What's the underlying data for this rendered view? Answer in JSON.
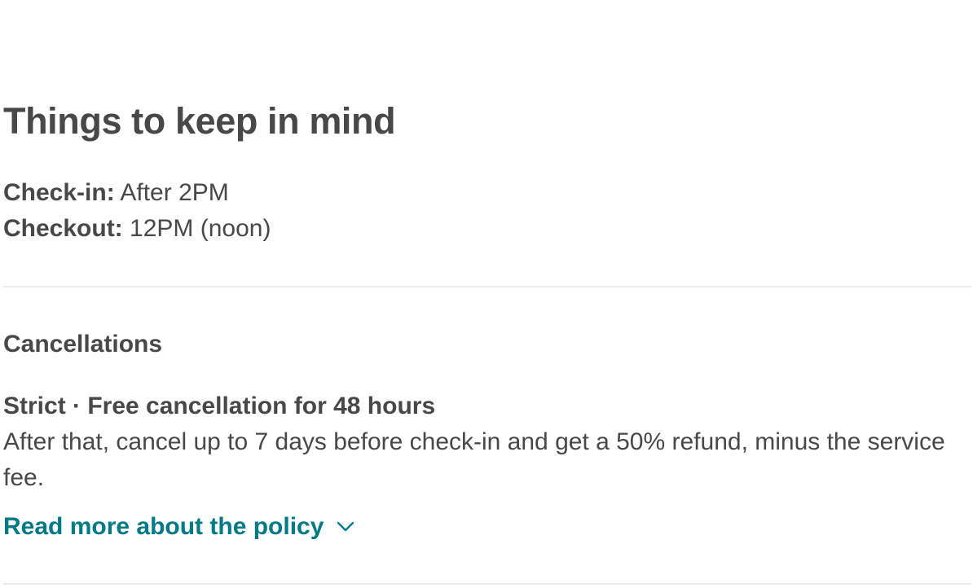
{
  "section": {
    "heading": "Things to keep in mind"
  },
  "house_rules": {
    "checkin_label": "Check-in:",
    "checkin_value": "After 2PM",
    "checkout_label": "Checkout:",
    "checkout_value": "12PM (noon)"
  },
  "cancellations": {
    "title": "Cancellations",
    "policy_title": "Strict · Free cancellation for 48 hours",
    "policy_text": "After that, cancel up to 7 days before check-in and get a 50% refund, minus the service fee.",
    "read_more_label": "Read more about the policy",
    "read_more_icon": "chevron-down-icon"
  },
  "colors": {
    "text": "#484848",
    "link": "#007a87",
    "divider": "#ebebeb"
  }
}
